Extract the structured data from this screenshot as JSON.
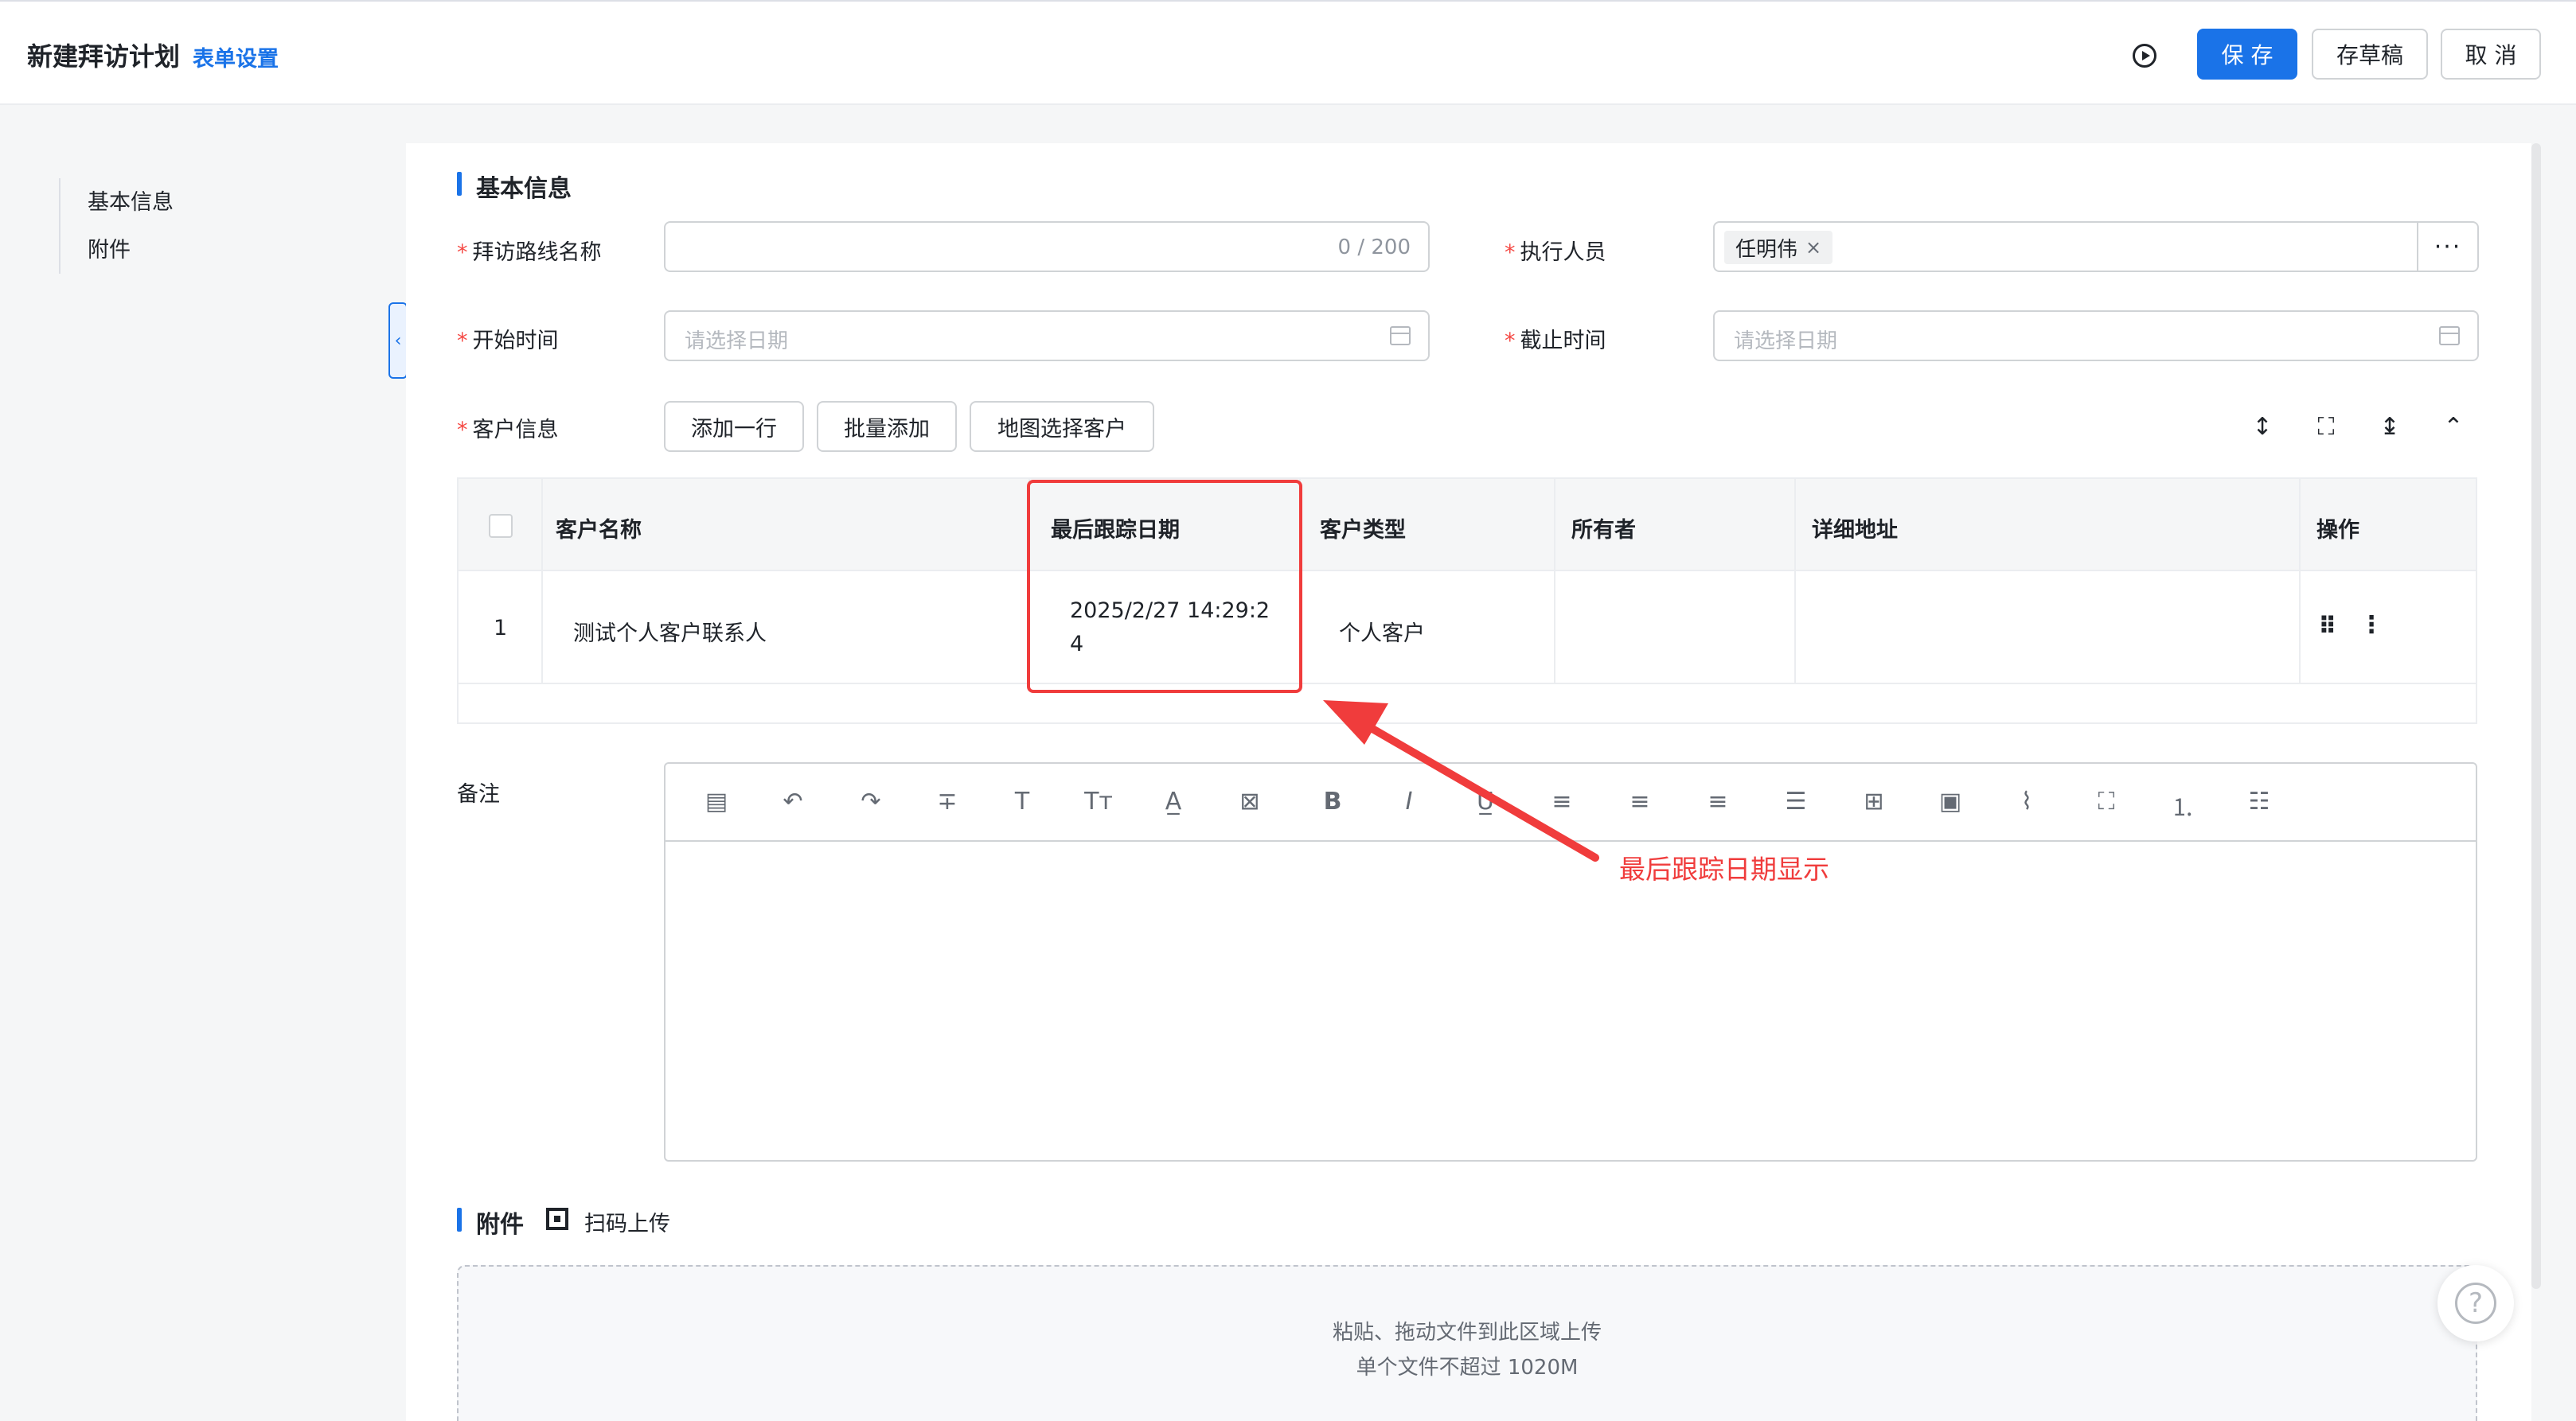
{
  "header": {
    "title": "新建拜访计划",
    "form_settings": "表单设置",
    "save": "保 存",
    "draft": "存草稿",
    "cancel": "取 消"
  },
  "sidebar": {
    "items": [
      "基本信息",
      "附件"
    ]
  },
  "basic_section": {
    "title": "基本信息",
    "route_name_label": "拜访路线名称",
    "route_name_counter": "0 / 200",
    "executor_label": "执行人员",
    "executor_tag": "任明伟",
    "start_time_label": "开始时间",
    "start_time_placeholder": "请选择日期",
    "end_time_label": "截止时间",
    "end_time_placeholder": "请选择日期",
    "customer_label": "客户信息",
    "add_row": "添加一行",
    "batch_add": "批量添加",
    "map_select": "地图选择客户"
  },
  "table": {
    "headers": [
      "客户名称",
      "最后跟踪日期",
      "客户类型",
      "所有者",
      "详细地址",
      "操作"
    ],
    "rows": [
      {
        "index": "1",
        "name": "测试个人客户联系人",
        "last_track_line1": "2025/2/27 14:29:2",
        "last_track_line2": "4",
        "type": "个人客户",
        "owner": "",
        "address": ""
      }
    ]
  },
  "remark": {
    "label": "备注"
  },
  "annotation": "最后跟踪日期显示",
  "attachment": {
    "title": "附件",
    "scan_upload": "扫码上传",
    "hint1": "粘贴、拖动文件到此区域上传",
    "hint2": "单个文件不超过 1020M"
  },
  "colors": {
    "primary": "#1a73e8",
    "required": "#f54a45",
    "annotation": "#f03c3c"
  }
}
